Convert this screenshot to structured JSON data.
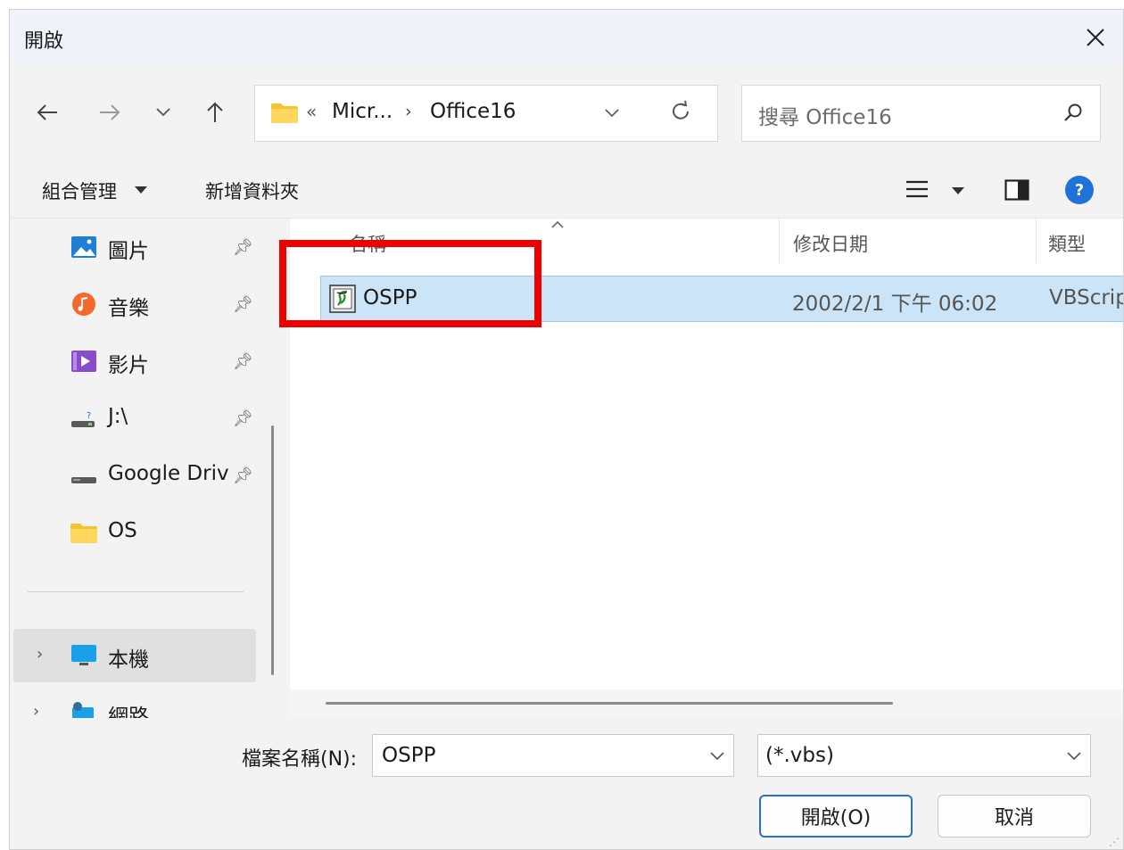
{
  "window": {
    "title": "開啟"
  },
  "address": {
    "overflow_glyph": "«",
    "parts": [
      "Micr...",
      "Office16"
    ],
    "separator": "›"
  },
  "search": {
    "placeholder": "搜尋 Office16"
  },
  "toolbar": {
    "organize_label": "組合管理",
    "new_folder_label": "新增資料夾"
  },
  "sidebar": {
    "items": [
      {
        "label": "圖片",
        "icon": "pictures-icon",
        "pinned": true
      },
      {
        "label": "音樂",
        "icon": "music-icon",
        "pinned": true
      },
      {
        "label": "影片",
        "icon": "videos-icon",
        "pinned": true
      },
      {
        "label": "J:\\",
        "icon": "network-drive-icon",
        "pinned": true
      },
      {
        "label": "Google Driv",
        "icon": "drive-icon",
        "pinned": true
      },
      {
        "label": "OS",
        "icon": "folder-icon",
        "pinned": false
      }
    ],
    "tree": [
      {
        "label": "本機",
        "icon": "this-pc-icon",
        "selected": true
      },
      {
        "label": "網路",
        "icon": "network-icon",
        "selected": false
      }
    ]
  },
  "columns": {
    "name": "名稱",
    "date": "修改日期",
    "type": "類型"
  },
  "files": [
    {
      "name": "OSPP",
      "date": "2002/2/1 下午 06:02",
      "type": "VBScrip",
      "icon": "vbscript-file-icon",
      "selected": true
    }
  ],
  "bottom": {
    "filename_label": "檔案名稱(N):",
    "filename_value": "OSPP",
    "filter_value": "(*.vbs)",
    "open_label": "開啟(O)",
    "cancel_label": "取消"
  },
  "colors": {
    "accent": "#1e72d8",
    "selection": "#cce4f7",
    "highlight_box": "#ee0000"
  }
}
